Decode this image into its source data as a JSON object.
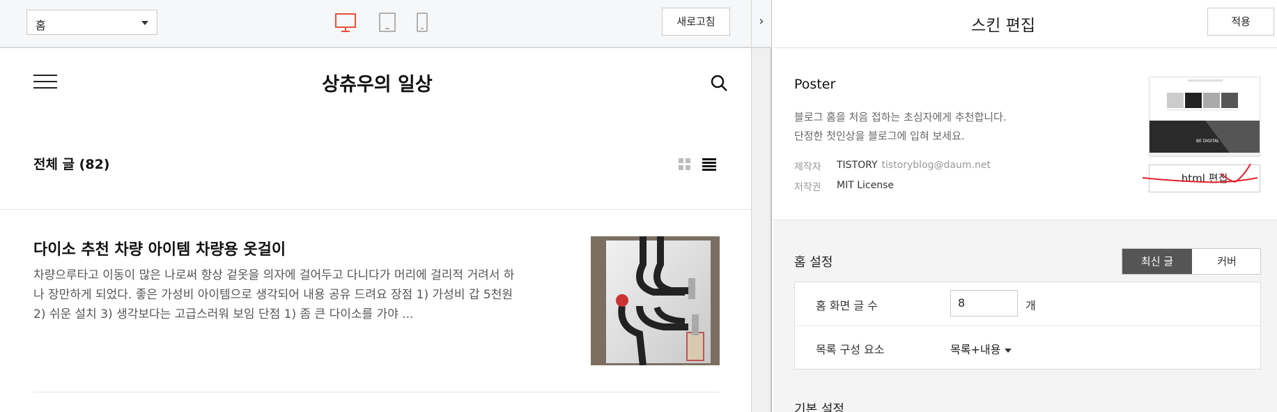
{
  "preview": {
    "page_select": {
      "value": "홈"
    },
    "devices": [
      {
        "name": "desktop",
        "icon": "monitor-icon",
        "active": true
      },
      {
        "name": "tablet",
        "icon": "tablet-icon",
        "active": false
      },
      {
        "name": "mobile",
        "icon": "phone-icon",
        "active": false
      }
    ],
    "refresh_label": "새로고침",
    "collapse_icon": "chevron-right-icon",
    "blog": {
      "title": "상츄우의 일상",
      "section_title": "전체 글 (82)",
      "posts": [
        {
          "title": "다이소 추천 차량 아이템 차량용 옷걸이",
          "excerpt": "차량으루타고 이동이 많은 나로써 항상 겉옷을 의자에 걸어두고 다니다가 머리에 걸리적 거려서 하나 장만하게 되었다. 좋은 가성비 아이템으로 생각되어 내용 공유 드려요 장점 1) 가성비 갑 5천원 2) 쉬운 설치 3) 생각보다는 고급스러워 보임 단점 1) 좀 큰 다이소를 가야 ..."
        }
      ]
    }
  },
  "skin_editor": {
    "title": "스킨 편집",
    "apply_label": "적용",
    "skin": {
      "name": "Poster",
      "description_line1": "블로그 홈을 처음 접하는 초심자에게 추천합니다.",
      "description_line2": "단정한 첫인상을 블로그에 입혀 보세요.",
      "author_label": "제작자",
      "author_value": "TISTORY",
      "author_email": "tistoryblog@daum.net",
      "license_label": "저작권",
      "license_value": "MIT License",
      "preview_caption": "BE DIGITAL",
      "html_edit_label": "html 편집"
    },
    "home_settings": {
      "title": "홈 설정",
      "mode_options": [
        "최신 글",
        "커버"
      ],
      "selected_mode": "최신 글",
      "posts_count_label": "홈 화면 글 수",
      "posts_count_value": "8",
      "posts_count_unit": "개",
      "list_component_label": "목록 구성 요소",
      "list_component_value": "목록+내용"
    },
    "basic_settings_title": "기본 설정"
  },
  "colors": {
    "accent_device": "#e8503a",
    "annotation": "#e8202a",
    "segment_active": "#555555"
  }
}
